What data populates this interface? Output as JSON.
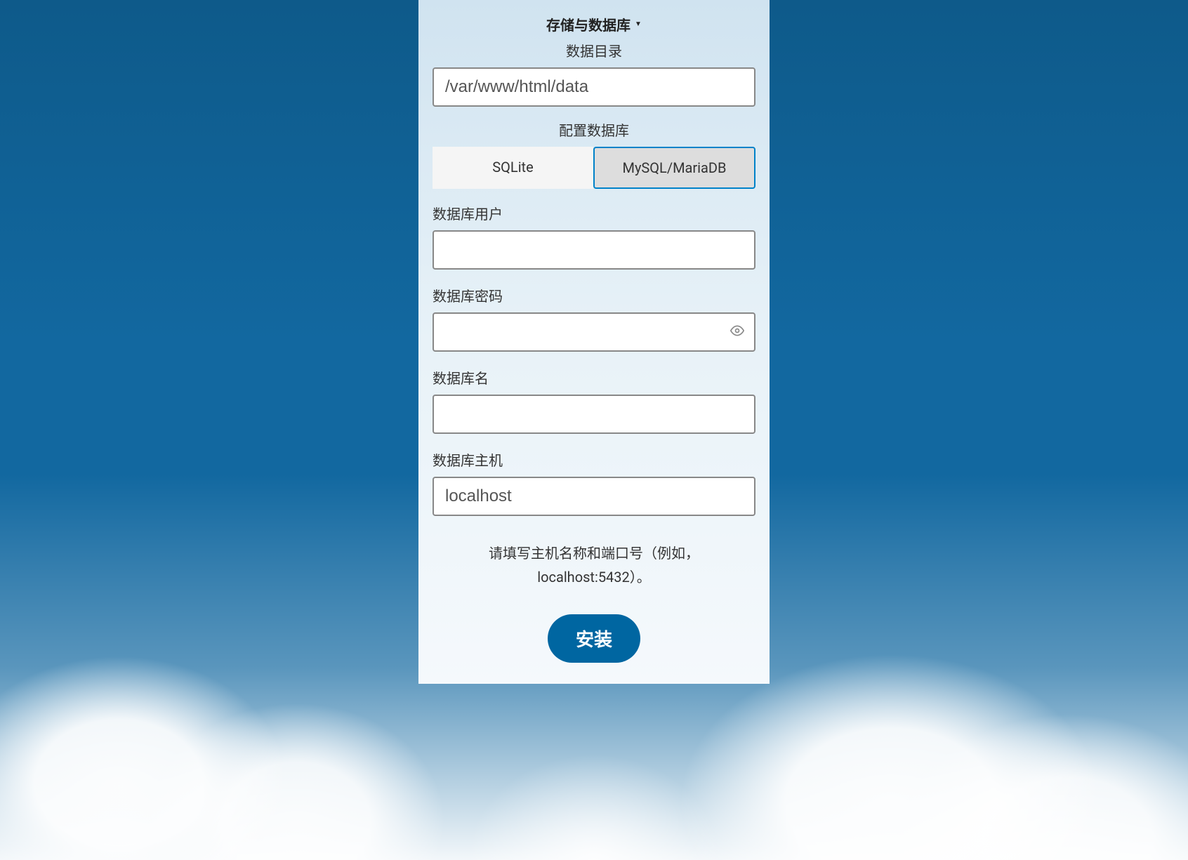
{
  "storage": {
    "section_title": "存储与数据库",
    "data_dir_label": "数据目录",
    "data_dir_value": "/var/www/html/data"
  },
  "database": {
    "config_label": "配置数据库",
    "tabs": {
      "sqlite": "SQLite",
      "mysql": "MySQL/MariaDB"
    },
    "selected_tab": "mysql",
    "user_label": "数据库用户",
    "user_value": "",
    "password_label": "数据库密码",
    "password_value": "",
    "name_label": "数据库名",
    "name_value": "",
    "host_label": "数据库主机",
    "host_value": "localhost",
    "host_hint": "请填写主机名称和端口号（例如，localhost:5432）。"
  },
  "install_button": "安装"
}
